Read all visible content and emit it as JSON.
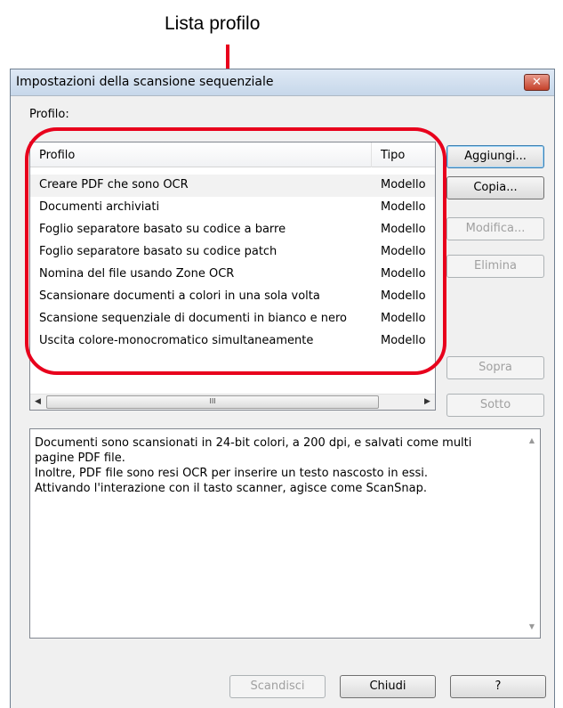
{
  "callout": {
    "label": "Lista profilo"
  },
  "window": {
    "title": "Impostazioni della scansione sequenziale",
    "close_glyph": "✕"
  },
  "profile_section": {
    "label": "Profilo:"
  },
  "list": {
    "columns": [
      "Profilo",
      "Tipo"
    ],
    "rows": [
      {
        "name": "Creare PDF che sono OCR",
        "type": "Modello",
        "selected": true
      },
      {
        "name": "Documenti archiviati",
        "type": "Modello"
      },
      {
        "name": "Foglio separatore basato su codice a barre",
        "type": "Modello"
      },
      {
        "name": "Foglio separatore basato su codice patch",
        "type": "Modello"
      },
      {
        "name": "Nomina del file usando Zone OCR",
        "type": "Modello"
      },
      {
        "name": "Scansionare documenti a colori in una sola volta",
        "type": "Modello"
      },
      {
        "name": "Scansione sequenziale di documenti in bianco e nero",
        "type": "Modello"
      },
      {
        "name": "Uscita colore-monocromatico simultaneamente",
        "type": "Modello"
      }
    ],
    "scroll_left": "◀",
    "scroll_right": "▶",
    "scroll_grip": "III"
  },
  "buttons": {
    "add": "Aggiungi...",
    "copy": "Copia...",
    "modify": "Modifica...",
    "delete": "Elimina",
    "up": "Sopra",
    "down": "Sotto",
    "scan": "Scandisci",
    "close": "Chiudi",
    "help": "?"
  },
  "description": {
    "text": "Documenti sono scansionati in 24-bit colori, a 200 dpi, e salvati come multi\npagine PDF file.\nInoltre, PDF file sono resi OCR per inserire un testo nascosto in essi.\nAttivando l'interazione con il tasto scanner, agisce come ScanSnap.",
    "scroll_up": "▲",
    "scroll_down": "▼"
  },
  "colors": {
    "highlight": "#e8001c",
    "selected_row": "#f2f2f2"
  }
}
